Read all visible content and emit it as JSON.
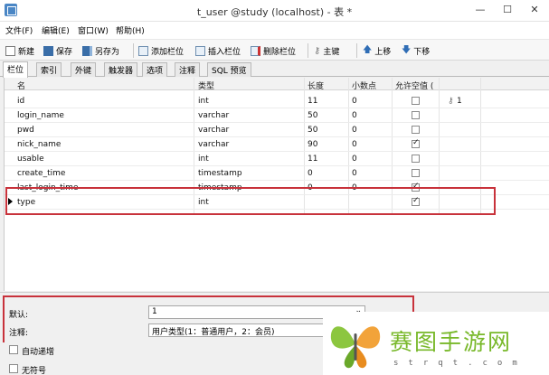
{
  "window": {
    "title": "t_user @study (localhost) - 表 *",
    "minimize": "—",
    "maximize": "☐",
    "close": "✕"
  },
  "menu": [
    "文件(F)",
    "编辑(E)",
    "窗口(W)",
    "帮助(H)"
  ],
  "toolbar": {
    "new": "新建",
    "save": "保存",
    "save_as": "另存为",
    "add_field": "添加栏位",
    "insert_field": "插入栏位",
    "delete_field": "删除栏位",
    "primary_key": "主键",
    "move_up": "上移",
    "move_down": "下移"
  },
  "tabs": [
    "栏位",
    "索引",
    "外键",
    "触发器",
    "选项",
    "注释",
    "SQL 预览"
  ],
  "columns": [
    "名",
    "类型",
    "长度",
    "小数点",
    "允许空值 ("
  ],
  "rows": [
    {
      "name": "id",
      "type": "int",
      "length": "11",
      "decimals": "0",
      "nullable": false,
      "key": "1"
    },
    {
      "name": "login_name",
      "type": "varchar",
      "length": "50",
      "decimals": "0",
      "nullable": false,
      "key": ""
    },
    {
      "name": "pwd",
      "type": "varchar",
      "length": "50",
      "decimals": "0",
      "nullable": false,
      "key": ""
    },
    {
      "name": "nick_name",
      "type": "varchar",
      "length": "90",
      "decimals": "0",
      "nullable": true,
      "key": ""
    },
    {
      "name": "usable",
      "type": "int",
      "length": "11",
      "decimals": "0",
      "nullable": false,
      "key": ""
    },
    {
      "name": "create_time",
      "type": "timestamp",
      "length": "0",
      "decimals": "0",
      "nullable": false,
      "key": ""
    },
    {
      "name": "last_login_time",
      "type": "timestamp",
      "length": "0",
      "decimals": "0",
      "nullable": true,
      "key": ""
    },
    {
      "name": "type",
      "type": "int",
      "length": "",
      "decimals": "",
      "nullable": true,
      "key": ""
    }
  ],
  "properties": {
    "default_label": "默认:",
    "default_value": "1",
    "comment_label": "注释:",
    "comment_value": "用户类型(1：普通用户，2：会员)",
    "auto_increment_label": "自动递增",
    "unsigned_label": "无符号"
  },
  "watermark": {
    "brand": "赛图手游网",
    "sub": "strqt.com"
  }
}
